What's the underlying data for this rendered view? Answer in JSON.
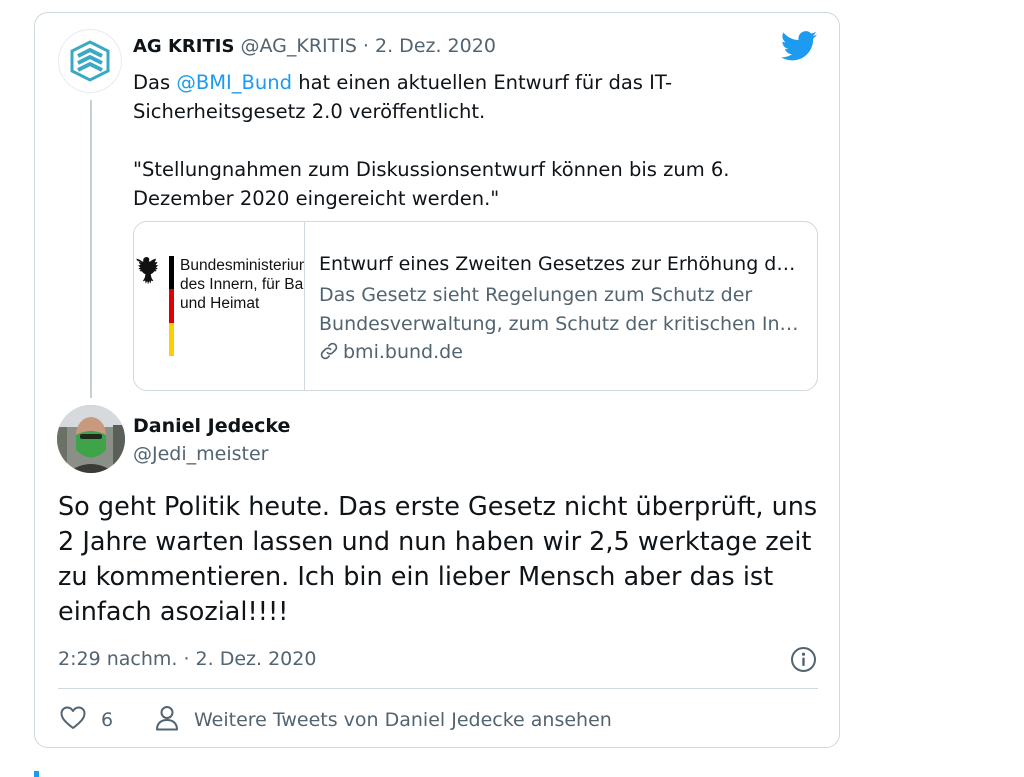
{
  "colors": {
    "accent": "#1d9bf0",
    "text_primary": "#0f1419",
    "text_secondary": "#536471",
    "border": "#cfd9de"
  },
  "embed": {
    "brand_icon": "twitter-bird-icon",
    "quoted_tweet": {
      "author_name": "AG KRITIS",
      "author_handle": "@AG_KRITIS",
      "separator": " · ",
      "date": "2. Dez. 2020",
      "text_before_mention": "Das ",
      "mention": "@BMI_Bund",
      "text_after_mention": " hat einen aktuellen Entwurf für das IT-Sicherheitsgesetz 2.0 veröffentlicht.\n\n\"Stellungnahmen zum Diskussionsentwurf können bis zum 6. Dezember 2020 eingereicht werden.\"",
      "link_card": {
        "thumbnail_text": "Bundesministerium\ndes Innern, für Bau\nund Heimat",
        "title": "Entwurf eines Zweiten Gesetzes zur Erhöhung der Sicherheit informationstechnischer Systeme",
        "description_line1": "Das Gesetz sieht Regelungen zum Schutz der",
        "description_line2": "Bundesverwaltung, zum Schutz der kritischen Infrastrukturen",
        "domain": "bmi.bund.de",
        "link_icon": "link-icon"
      }
    },
    "tweet": {
      "author_name": "Daniel Jedecke",
      "author_handle": "@Jedi_meister",
      "text": "So geht Politik heute. Das erste Gesetz nicht überprüft, uns 2 Jahre warten lassen und nun haben wir 2,5 werktage zeit zu kommentieren. Ich bin ein lieber Mensch aber das ist einfach asozial!!!!",
      "timestamp": "2:29 nachm. · 2. Dez. 2020",
      "info_icon": "info-icon"
    },
    "actions": {
      "like_icon": "heart-icon",
      "like_count": "6",
      "more_icon": "person-icon",
      "more_tweets_label": "Weitere Tweets von Daniel Jedecke ansehen"
    }
  }
}
